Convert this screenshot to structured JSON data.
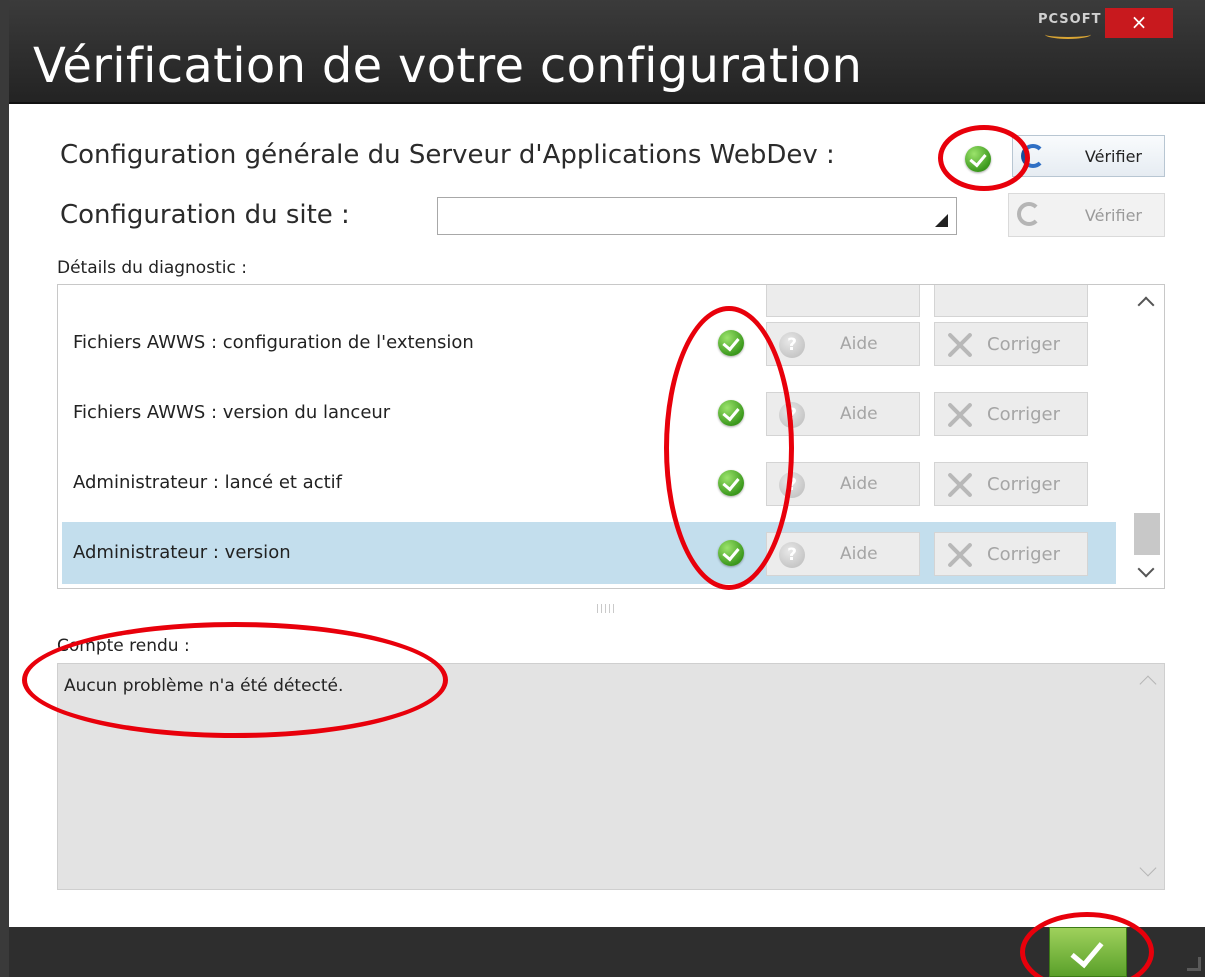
{
  "window": {
    "title": "Vérification de votre configuration",
    "logo": "PCSOFT",
    "close_label": "×"
  },
  "general_config": {
    "label": "Configuration générale du Serveur d'Applications WebDev :",
    "status": "ok",
    "verify_label": "Vérifier"
  },
  "site_config": {
    "label": "Configuration du site :",
    "selected": "",
    "verify_label": "Vérifier"
  },
  "diagnostic": {
    "label": "Détails du diagnostic :",
    "rows": [
      {
        "text": "Fichiers AWWS : configuration de l'extension",
        "status": "ok",
        "help_label": "Aide",
        "fix_label": "Corriger",
        "selected": false
      },
      {
        "text": "Fichiers AWWS : version du lanceur",
        "status": "ok",
        "help_label": "Aide",
        "fix_label": "Corriger",
        "selected": false
      },
      {
        "text": "Administrateur : lancé et actif",
        "status": "ok",
        "help_label": "Aide",
        "fix_label": "Corriger",
        "selected": false
      },
      {
        "text": "Administrateur : version",
        "status": "ok",
        "help_label": "Aide",
        "fix_label": "Corriger",
        "selected": true
      }
    ]
  },
  "report": {
    "label": "Compte rendu :",
    "text": "Aucun problème n'a été détecté."
  },
  "colors": {
    "header_bg": "#2b2b2b",
    "close_bg": "#c8191e",
    "ok_green": "#6db33f",
    "selected_row": "#c3deed",
    "annotation_red": "#e8000b"
  },
  "icons": [
    "close-icon",
    "check-icon",
    "refresh-icon",
    "help-icon",
    "tools-icon",
    "chevron-up-icon",
    "chevron-down-icon",
    "dropdown-arrow-icon"
  ]
}
